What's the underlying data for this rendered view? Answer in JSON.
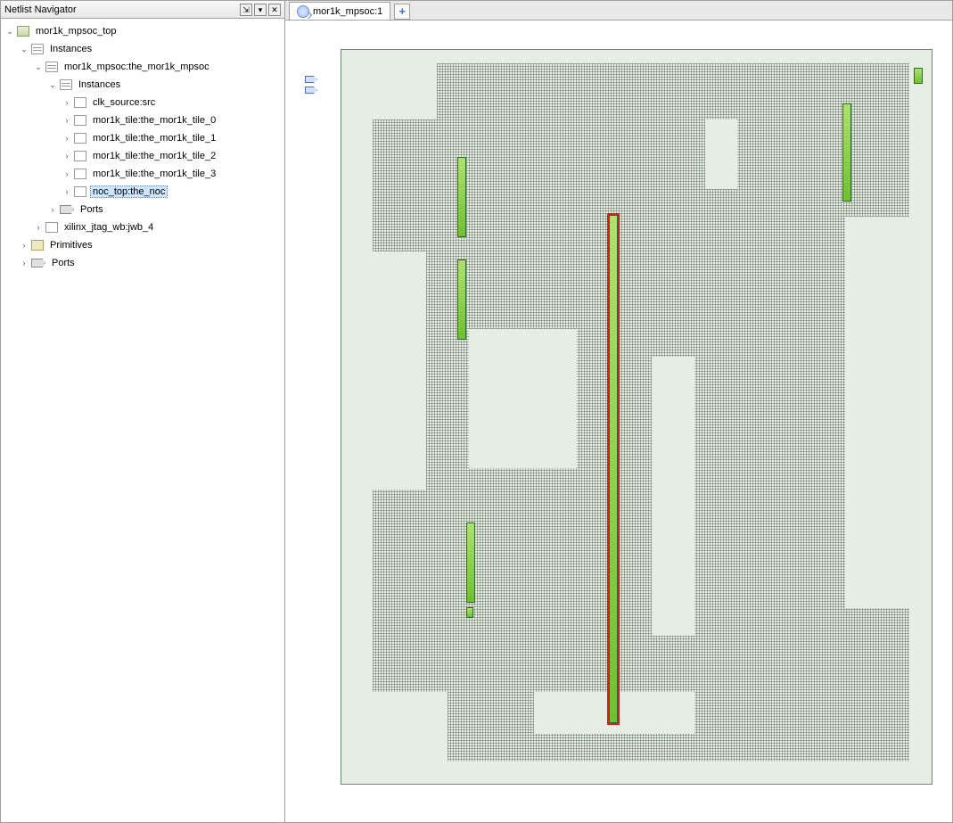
{
  "panel": {
    "title": "Netlist Navigator",
    "pin_tip": "Auto Hide",
    "dock_tip": "Window Position",
    "close_tip": "Close"
  },
  "tree": {
    "root": "mor1k_mpsoc_top",
    "l1_instances": "Instances",
    "l2_mpsoc": "mor1k_mpsoc:the_mor1k_mpsoc",
    "l3_instances": "Instances",
    "leaf_clk": "clk_source:src",
    "leaf_t0": "mor1k_tile:the_mor1k_tile_0",
    "leaf_t1": "mor1k_tile:the_mor1k_tile_1",
    "leaf_t2": "mor1k_tile:the_mor1k_tile_2",
    "leaf_t3": "mor1k_tile:the_mor1k_tile_3",
    "leaf_noc": "noc_top:the_noc",
    "l3_ports": "Ports",
    "l2_jtag": "xilinx_jtag_wb:jwb_4",
    "l1_primitives": "Primitives",
    "l1_ports": "Ports"
  },
  "tabs": {
    "tab1": "mor1k_mpsoc:1",
    "add": "+"
  },
  "glyph": {
    "open": "⌄",
    "closed": "›",
    "pin": "⇲",
    "dock": "▾",
    "close": "✕"
  }
}
